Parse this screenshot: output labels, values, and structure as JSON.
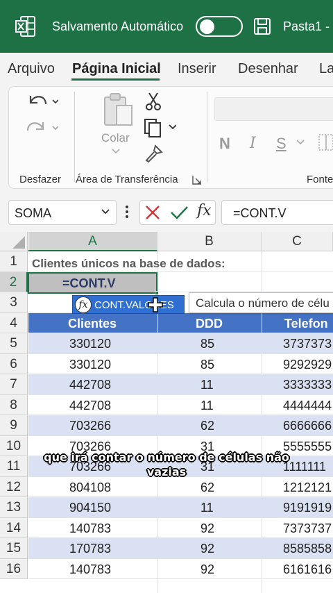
{
  "titlebar": {
    "autosave_label": "Salvamento Automático",
    "autosave_on": false,
    "file_name": "Pasta1  -",
    "bg_color": "#1e7145"
  },
  "tabs": [
    "Arquivo",
    "Página Inicial",
    "Inserir",
    "Desenhar",
    "La"
  ],
  "active_tab": "Página Inicial",
  "ribbon": {
    "undo_group": "Desfazer",
    "clipboard_group": "Área de Transferência",
    "paste_label": "Colar",
    "font_group": "Fonte",
    "format_buttons": [
      "N",
      "I",
      "S"
    ]
  },
  "formula_bar": {
    "name_box": "SOMA",
    "fx": "fx",
    "formula": "=CONT.V"
  },
  "grid": {
    "columns": [
      "A",
      "B",
      "C"
    ],
    "row_numbers": [
      "1",
      "2",
      "3",
      "4",
      "5",
      "6",
      "7",
      "8",
      "9",
      "10",
      "11",
      "12",
      "13",
      "14",
      "15",
      "16"
    ],
    "title_text": "Clientes únicos na base de dados:",
    "active_cell_text": "=CONT.V",
    "headers": [
      "Clientes",
      "DDD",
      "Telefon"
    ],
    "rows": [
      [
        "330120",
        "85",
        "3737373"
      ],
      [
        "330120",
        "85",
        "9292929"
      ],
      [
        "442708",
        "11",
        "3333333"
      ],
      [
        "442708",
        "11",
        "4444444"
      ],
      [
        "703266",
        "62",
        "6666666"
      ],
      [
        "703266",
        "31",
        "5555555"
      ],
      [
        "703266",
        "31",
        "1111111"
      ],
      [
        "804108",
        "62",
        "1212121"
      ],
      [
        "904150",
        "11",
        "9191919"
      ],
      [
        "140783",
        "92",
        "7373737"
      ],
      [
        "170783",
        "92",
        "8585858"
      ],
      [
        "140783",
        "92",
        "6161616"
      ]
    ],
    "header_color": "#4472c4",
    "band_color": "#d9e1f2"
  },
  "autocomplete": {
    "icon": "fx",
    "suggestion": "CONT.VALORES",
    "tooltip": "Calcula o número de célu"
  },
  "caption": "que irá contar o número de células não vazias"
}
